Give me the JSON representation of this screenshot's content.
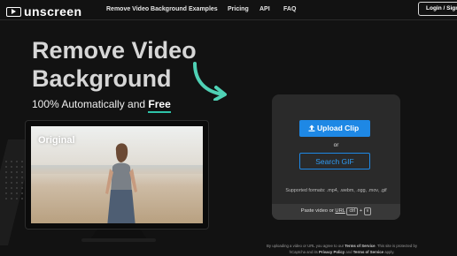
{
  "nav": {
    "logo_text": "unscreen",
    "links": [
      "Remove Video Background",
      "Examples",
      "Pricing",
      "API",
      "FAQ"
    ],
    "login_label": "Login / Sign"
  },
  "hero": {
    "title_line1": "Remove Video",
    "title_line2": "Background",
    "subtitle_prefix": "100% Automatically and ",
    "subtitle_emphasis": "Free"
  },
  "preview": {
    "label": "Original"
  },
  "upload": {
    "upload_label": "Upload Clip",
    "or_text": "or",
    "search_gif_label": "Search GIF",
    "formats_text": "Supported formats: .mp4, .webm, .ogg, .mov, .gif",
    "paste_text": "Paste video or",
    "paste_link": "URL",
    "ctrl_key": "ctrl",
    "plus": "+",
    "v_key": "v"
  },
  "legal": {
    "part1": "By uploading a video or URL you agree to our ",
    "terms": "Terms of Service",
    "part2": ". This site is protected by hCaptcha and its ",
    "privacy": "Privacy Policy",
    "part3": " and ",
    "terms2": "Terms of Service",
    "part4": " apply."
  },
  "colors": {
    "background": "#121212",
    "panel": "#2a2a2a",
    "accent_blue": "#1e88e5",
    "accent_teal": "#4fd1b5"
  }
}
